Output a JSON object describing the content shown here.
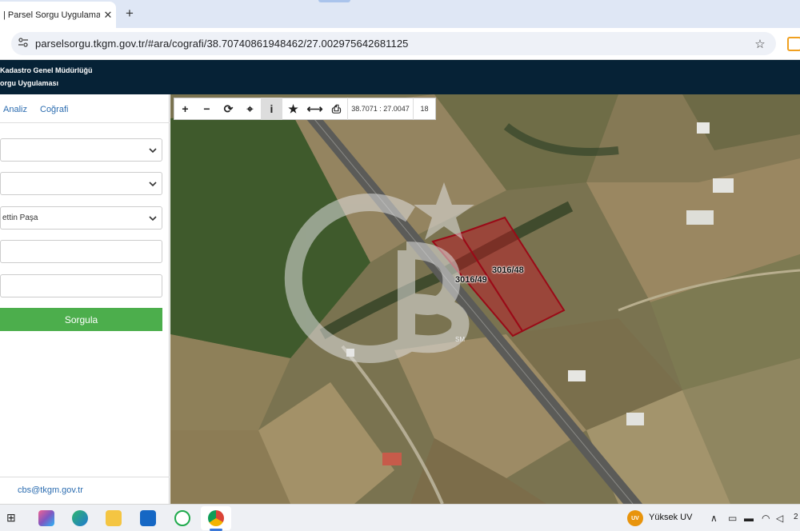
{
  "browser": {
    "tab_title": "| Parsel Sorgu Uygulaması",
    "tab_close": "✕",
    "new_tab": "+",
    "url": "parselsorgu.tkgm.gov.tr/#ara/cografi/38.70740861948462/27.002975642681125"
  },
  "site": {
    "title_line1": "Kadastro Genel Müdürlüğü",
    "title_line2": "orgu Uygulaması"
  },
  "panel": {
    "tabs": [
      {
        "label": "Analiz"
      },
      {
        "label": "Coğrafi"
      }
    ],
    "fields": [
      {
        "value": ""
      },
      {
        "value": ""
      },
      {
        "value": "ettin Paşa"
      },
      {
        "value": ""
      },
      {
        "value": ""
      }
    ],
    "query_button": "Sorgula",
    "footer_email": "cbs@tkgm.gov.tr"
  },
  "map": {
    "coordinates": "38.7071 : 27.0047",
    "zoom_level": "18",
    "parcels": [
      {
        "label": "3016/48"
      },
      {
        "label": "3016/49"
      }
    ],
    "watermark_text": "SM",
    "parcel_color": "#c0101e"
  },
  "taskbar": {
    "weather_badge": "UV",
    "weather_text": "Yüksek UV",
    "clock_partial": "2"
  }
}
